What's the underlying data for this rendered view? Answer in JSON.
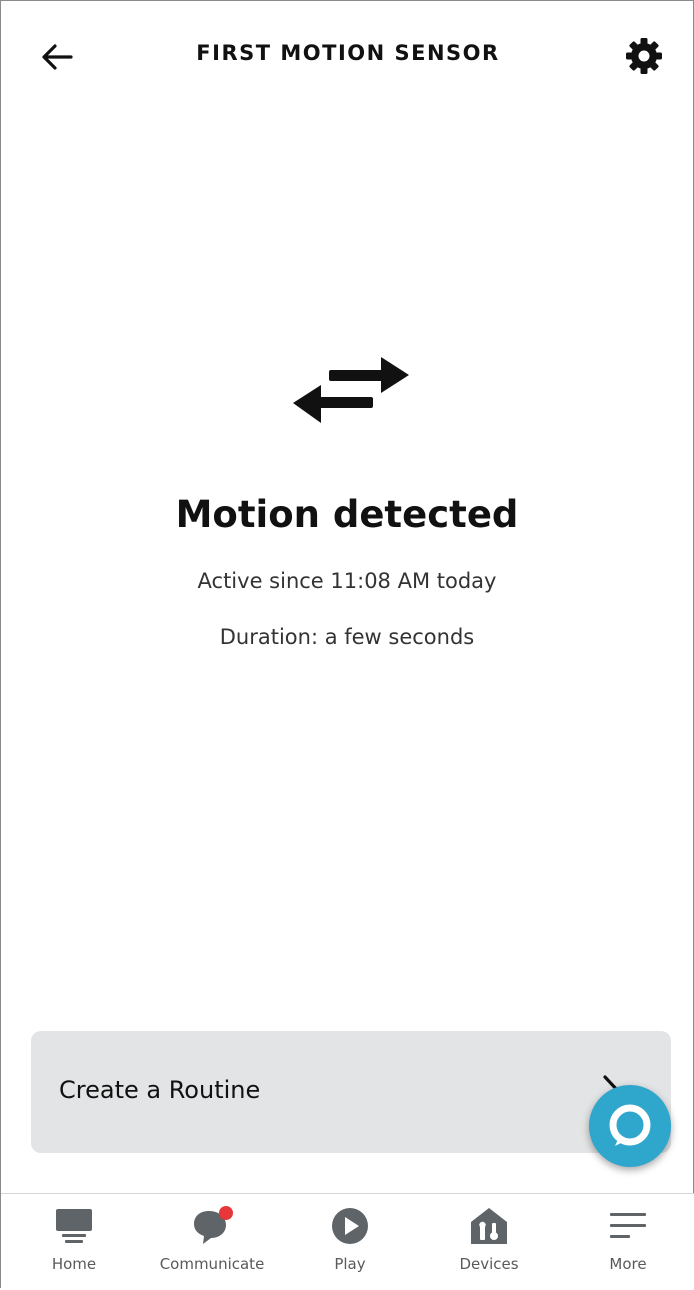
{
  "header": {
    "title": "FIRST MOTION SENSOR",
    "back_icon": "arrow-left-icon",
    "settings_icon": "gear-icon"
  },
  "status": {
    "icon": "swap-arrows-icon",
    "title": "Motion detected",
    "since": "Active since 11:08 AM today",
    "duration": "Duration: a few seconds"
  },
  "routine": {
    "label": "Create a Routine",
    "chevron_icon": "chevron-right-icon"
  },
  "alexa_button": {
    "icon": "alexa-ring-icon",
    "color": "#2fa6cc"
  },
  "colors": {
    "nav_icon": "#5f6468",
    "notification_dot": "#e8373a",
    "card_background": "#e3e4e5"
  },
  "bottom_nav": {
    "items": [
      {
        "label": "Home",
        "icon": "home-icon"
      },
      {
        "label": "Communicate",
        "icon": "chat-bubble-icon",
        "badge": true
      },
      {
        "label": "Play",
        "icon": "play-icon"
      },
      {
        "label": "Devices",
        "icon": "devices-icon"
      },
      {
        "label": "More",
        "icon": "menu-icon"
      }
    ]
  }
}
